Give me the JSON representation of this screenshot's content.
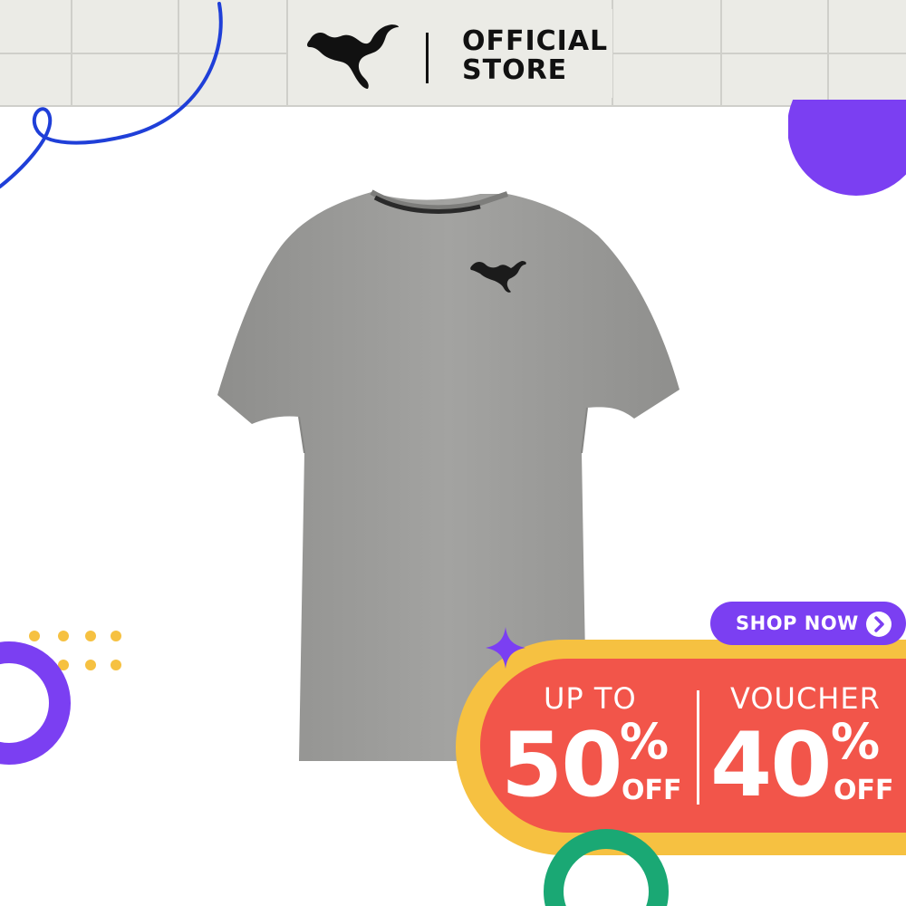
{
  "header": {
    "brand_logo": "puma-cat-logo",
    "store_label_line1": "OFFICIAL",
    "store_label_line2": "STORE"
  },
  "product": {
    "image": "grey-puma-tshirt"
  },
  "promo": {
    "shop_now_label": "SHOP NOW",
    "shop_now_icon": "chevron-right-icon",
    "left_caption": "UP TO",
    "left_value": "50",
    "left_percent": "%",
    "left_off": "OFF",
    "right_caption": "VOUCHER",
    "right_value": "40",
    "right_percent": "%",
    "right_off": "OFF"
  },
  "colors": {
    "header_bg": "#ebebe6",
    "purple": "#7b3ff2",
    "promo_red": "#f2554a",
    "promo_yellow": "#f6c141",
    "accent_blue": "#1f3fd8",
    "accent_green": "#1aa874",
    "shirt_grey": "#9a9a98"
  }
}
